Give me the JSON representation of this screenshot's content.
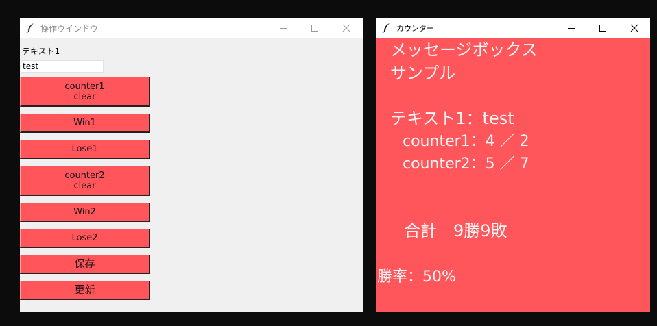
{
  "op_window": {
    "title": "操作ウインドウ",
    "icon": "feather-icon",
    "label": "テキスト1",
    "input_value": "test",
    "buttons": {
      "counter1_clear": "counter1\nclear",
      "win1": "Win1",
      "lose1": "Lose1",
      "counter2_clear": "counter2\nclear",
      "win2": "Win2",
      "lose2": "Lose2",
      "save": "保存",
      "update": "更新"
    }
  },
  "counter_window": {
    "title": "カウンター",
    "icon": "feather-icon",
    "line1": "メッセージボックス",
    "line2": "サンプル",
    "text1": "テキスト1：test",
    "counter1": "counter1：4 ／ 2",
    "counter2": "counter2：5 ／ 7",
    "total": "合計　9勝9敗",
    "rate": "勝率：50%"
  },
  "colors": {
    "accent": "#ff555b",
    "counter_bg": "#ff565c",
    "op_bg": "#f0f0f0"
  }
}
